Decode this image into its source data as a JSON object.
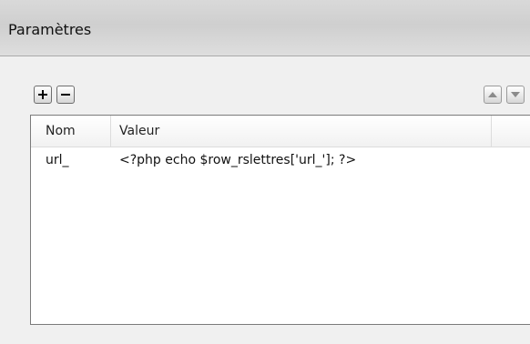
{
  "panel": {
    "title": "Paramètres"
  },
  "toolbar": {
    "add_icon": "plus-icon",
    "remove_icon": "minus-icon",
    "up_icon": "arrow-up-icon",
    "down_icon": "arrow-down-icon"
  },
  "table": {
    "columns": [
      "Nom",
      "Valeur"
    ],
    "rows": [
      {
        "name": "url_",
        "value": "<?php echo $row_rslettres['url_']; ?>"
      }
    ]
  }
}
